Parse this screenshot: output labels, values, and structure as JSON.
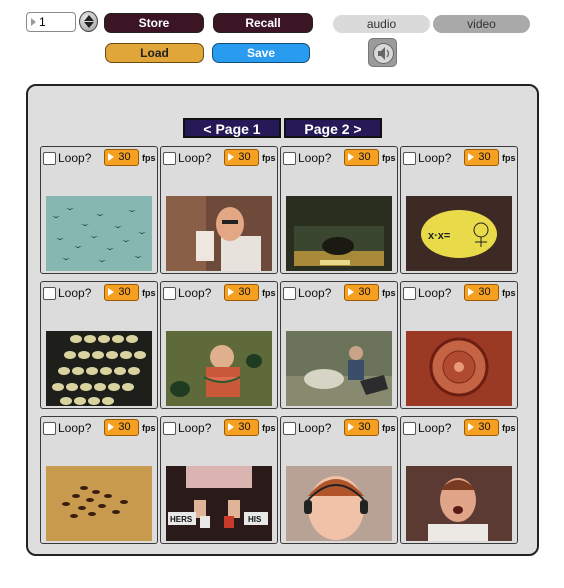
{
  "number_box": {
    "value": "1"
  },
  "buttons": {
    "store": "Store",
    "recall": "Recall",
    "load": "Load",
    "save": "Save"
  },
  "tabs": {
    "audio": "audio",
    "video": "video"
  },
  "pager": {
    "prev": "< Page 1",
    "next": "Page 2 >"
  },
  "cell_labels": {
    "loop": "Loop?",
    "fps_unit": "fps"
  },
  "cells": [
    {
      "fps": "30",
      "thumb": "flock-of-birds"
    },
    {
      "fps": "30",
      "thumb": "man-with-glasses"
    },
    {
      "fps": "30",
      "thumb": "animal-in-cage"
    },
    {
      "fps": "30",
      "thumb": "math-cartoon"
    },
    {
      "fps": "30",
      "thumb": "eggs-on-conveyor"
    },
    {
      "fps": "30",
      "thumb": "boy-eating-watermelon"
    },
    {
      "fps": "30",
      "thumb": "boy-with-sheep"
    },
    {
      "fps": "30",
      "thumb": "cell-microscope"
    },
    {
      "fps": "30",
      "thumb": "insects-swarm"
    },
    {
      "fps": "30",
      "thumb": "hands-with-cups"
    },
    {
      "fps": "30",
      "thumb": "baby-with-headphones"
    },
    {
      "fps": "30",
      "thumb": "man-singing"
    }
  ],
  "thumb_texts": {
    "hers": "HERS",
    "his": "HIS"
  },
  "colors": {
    "store_recall": "#3b1524",
    "load": "#e0a63a",
    "save": "#2a9cf0",
    "fps_box": "#f6a021",
    "pager": "#251a57"
  }
}
